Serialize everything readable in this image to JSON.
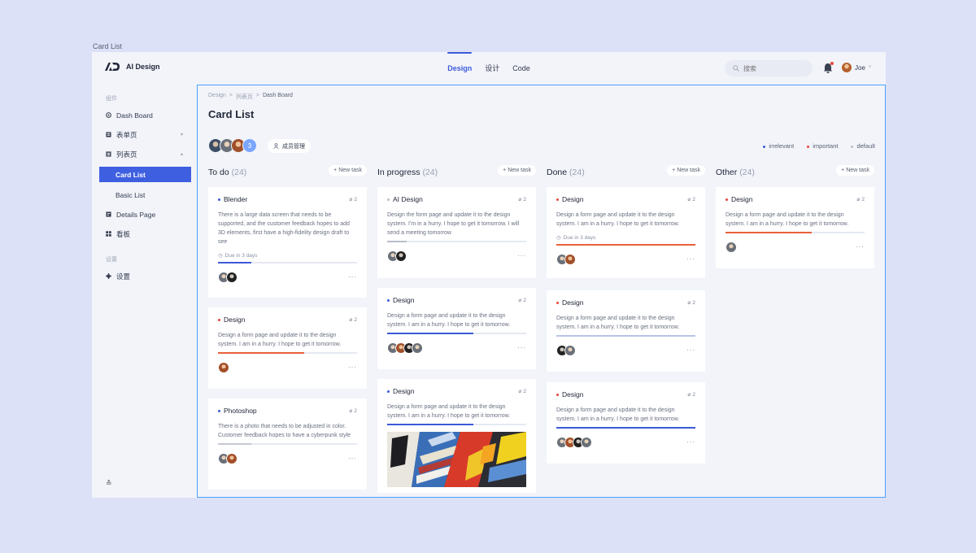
{
  "frame_label": "Card List",
  "header": {
    "app_name": "AI Design",
    "nav": [
      "Design",
      "设计",
      "Code"
    ],
    "search_placeholder": "搜索",
    "user_name": "Joe",
    "user_chevron": "˅"
  },
  "sidebar": {
    "group1": "组件",
    "items": {
      "dashboard": "Dash Board",
      "forms": "表单页",
      "lists": "列表页",
      "card_list": "Card List",
      "basic_list": "Basic List",
      "details": "Details Page",
      "board": "看板"
    },
    "group2": "设置",
    "settings": "设置",
    "collapse": "≛"
  },
  "breadcrumb": [
    "Design",
    ">",
    "列表页",
    ">",
    "Dash Board"
  ],
  "page_title": "Card List",
  "members": {
    "count": "3",
    "manage_label": "成员管理"
  },
  "legend": [
    {
      "label": "irrelevant",
      "color": "#3c5ad8"
    },
    {
      "label": "important",
      "color": "#e8463a"
    },
    {
      "label": "default",
      "color": "#b8bdc9"
    }
  ],
  "new_task_label": "+ New task",
  "columns": [
    {
      "title": "To do",
      "count": "(24)",
      "cards": [
        {
          "title": "Blender",
          "dot": "#3c5ad8",
          "attachments": "2",
          "desc": "There is a large data screen that needs to be supported, and the customer feedback hopes to add 3D elements, first have a high-fidelity design draft to see",
          "due": "Due in 3 days",
          "progress": 0.24,
          "progress_color": "#3c5ad8",
          "avatars": [
            "a2",
            "a4"
          ]
        },
        {
          "title": "Design",
          "dot": "#e8463a",
          "attachments": "2",
          "desc": "Design a form page and update it to the design system. I am in a hurry. I hope to get it tomorrow.",
          "progress": 0.62,
          "progress_color": "#e8603a",
          "avatars": [
            "a3"
          ]
        },
        {
          "title": "Photoshop",
          "dot": "#3c5ad8",
          "attachments": "2",
          "desc": "There is a photo that needs to be adjusted in color. Customer feedback hopes to have a cyberpunk style",
          "progress": 0.24,
          "progress_color": "#c5c9d4",
          "avatars": [
            "a2",
            "a3"
          ]
        }
      ]
    },
    {
      "title": "In progress",
      "count": "(24)",
      "cards": [
        {
          "title": "AI Design",
          "dot": "#b8bdc9",
          "attachments": "2",
          "desc": "Design the form page and update it to the design system. I'm in a hurry. I hope to get it tomorrow. I will send a meeting tomorrow",
          "progress": 0.14,
          "progress_color": "#b8bdc9",
          "avatars": [
            "a2",
            "a4"
          ]
        },
        {
          "title": "Design",
          "dot": "#3c5ad8",
          "attachments": "2",
          "desc": "Design a form page and update it to the design system. I am in a hurry. I hope to get it tomorrow.",
          "progress": 0.62,
          "progress_color": "#3c5ad8",
          "avatars": [
            "a2",
            "a3",
            "a4",
            "a2"
          ]
        },
        {
          "title": "Design",
          "dot": "#3c5ad8",
          "attachments": "2",
          "desc": "Design a form page and update it to the design system. I am in a hurry. I hope to get it tomorrow.",
          "progress": 0.62,
          "progress_color": "#3c5ad8",
          "avatars": []
        }
      ]
    },
    {
      "title": "Done",
      "count": "(24)",
      "cards": [
        {
          "title": "Design",
          "dot": "#e8463a",
          "attachments": "2",
          "desc": "Design a form page and update it to the design system. I am in a hurry. I hope to get it tomorrow.",
          "due": "Due in 3 days",
          "progress": 1,
          "progress_color": "#e8603a",
          "avatars": [
            "a2",
            "a3"
          ]
        },
        {
          "title": "Design",
          "dot": "#e8463a",
          "attachments": "2",
          "desc": "Design a form page and update it to the design system. I am in a hurry. I hope to get it tomorrow.",
          "progress": 1,
          "progress_color": "#b8c4e8",
          "avatars": [
            "a4",
            "a2"
          ]
        },
        {
          "title": "Design",
          "dot": "#e8463a",
          "attachments": "2",
          "desc": "Design a form page and update it to the design system. I am in a hurry. I hope to get it tomorrow.",
          "progress": 1,
          "progress_color": "#3c5ad8",
          "avatars": [
            "a2",
            "a3",
            "a4",
            "a2"
          ]
        }
      ]
    },
    {
      "title": "Other",
      "count": "(24)",
      "cards": [
        {
          "title": "Design",
          "dot": "#e8463a",
          "attachments": "2",
          "desc": "Design a form page and update it to the design system. I am in a hurry. I hope to get it tomorrow.",
          "progress": 0.62,
          "progress_color": "#e8603a",
          "avatars": [
            "a2"
          ]
        }
      ]
    }
  ]
}
